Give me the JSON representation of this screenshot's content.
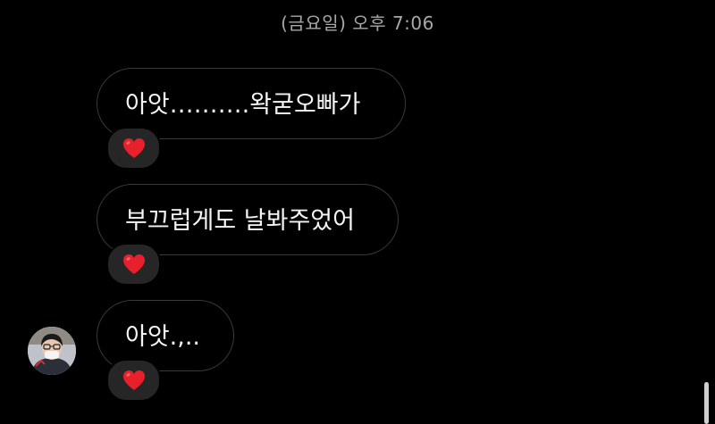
{
  "chat": {
    "timestamp": "(금요일) 오후 7:06",
    "messages": [
      {
        "text": "아앗……….왁굳오빠가",
        "reaction": "heart-icon"
      },
      {
        "text": "부끄럽게도 날봐주었어",
        "reaction": "heart-icon"
      },
      {
        "text": "아앗.,..",
        "reaction": "heart-icon"
      }
    ]
  },
  "colors": {
    "background": "#000000",
    "bubble_border": "#3a3a3a",
    "reaction_pill": "#262626",
    "heart": "#e8202c",
    "timestamp_text": "#a8a8a8"
  }
}
